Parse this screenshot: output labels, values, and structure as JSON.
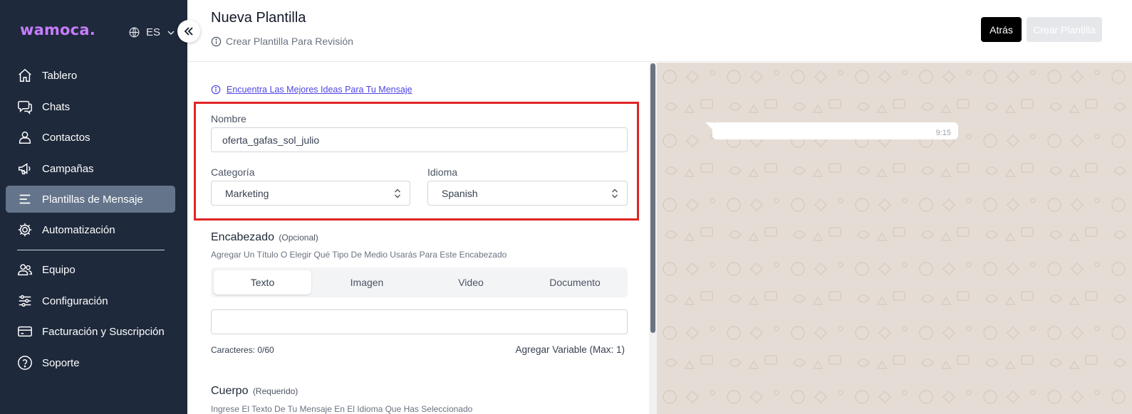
{
  "sidebar": {
    "logo": "wamoca.",
    "language": "ES",
    "items": [
      {
        "label": "Tablero",
        "icon": "home-icon"
      },
      {
        "label": "Chats",
        "icon": "chat-icon"
      },
      {
        "label": "Contactos",
        "icon": "user-icon"
      },
      {
        "label": "Campañas",
        "icon": "megaphone-icon"
      },
      {
        "label": "Plantillas de Mensaje",
        "icon": "template-icon",
        "active": true
      },
      {
        "label": "Automatización",
        "icon": "gear-icon"
      },
      {
        "label": "Equipo",
        "icon": "team-icon"
      },
      {
        "label": "Configuración",
        "icon": "sliders-icon"
      },
      {
        "label": "Facturación y Suscripción",
        "icon": "credit-card-icon"
      },
      {
        "label": "Soporte",
        "icon": "help-icon"
      }
    ]
  },
  "header": {
    "title": "Nueva Plantilla",
    "subtitle": "Crear Plantilla Para Revisión",
    "back_label": "Atrás",
    "create_label": "Crear Plantilla"
  },
  "form": {
    "tip_link": "Encuentra Las Mejores Ideas Para Tu Mensaje",
    "name_label": "Nombre",
    "name_value": "oferta_gafas_sol_julio",
    "category_label": "Categoría",
    "category_value": "Marketing",
    "language_label": "Idioma",
    "language_value": "Spanish",
    "header_section": {
      "title": "Encabezado",
      "tag": "(Opcional)",
      "helper": "Agregar Un Título O Elegir Qué Tipo De Medio Usarás Para Este Encabezado",
      "tabs": [
        "Texto",
        "Imagen",
        "Video",
        "Documento"
      ],
      "active_tab": "Texto",
      "text_value": "",
      "counter": "Caracteres: 0/60",
      "add_variable": "Agregar Variable (Max: 1)"
    },
    "body_section": {
      "title": "Cuerpo",
      "tag": "(Requerido)",
      "helper": "Ingrese El Texto De Tu Mensaje En El Idioma Que Has Seleccionado"
    }
  },
  "preview": {
    "time": "9:15",
    "message": ""
  },
  "colors": {
    "sidebar_bg": "#1e293b",
    "active_item": "#64748b",
    "logo": "#c77dff",
    "highlight": "#e02424",
    "preview_bg": "#e5ddd5"
  }
}
